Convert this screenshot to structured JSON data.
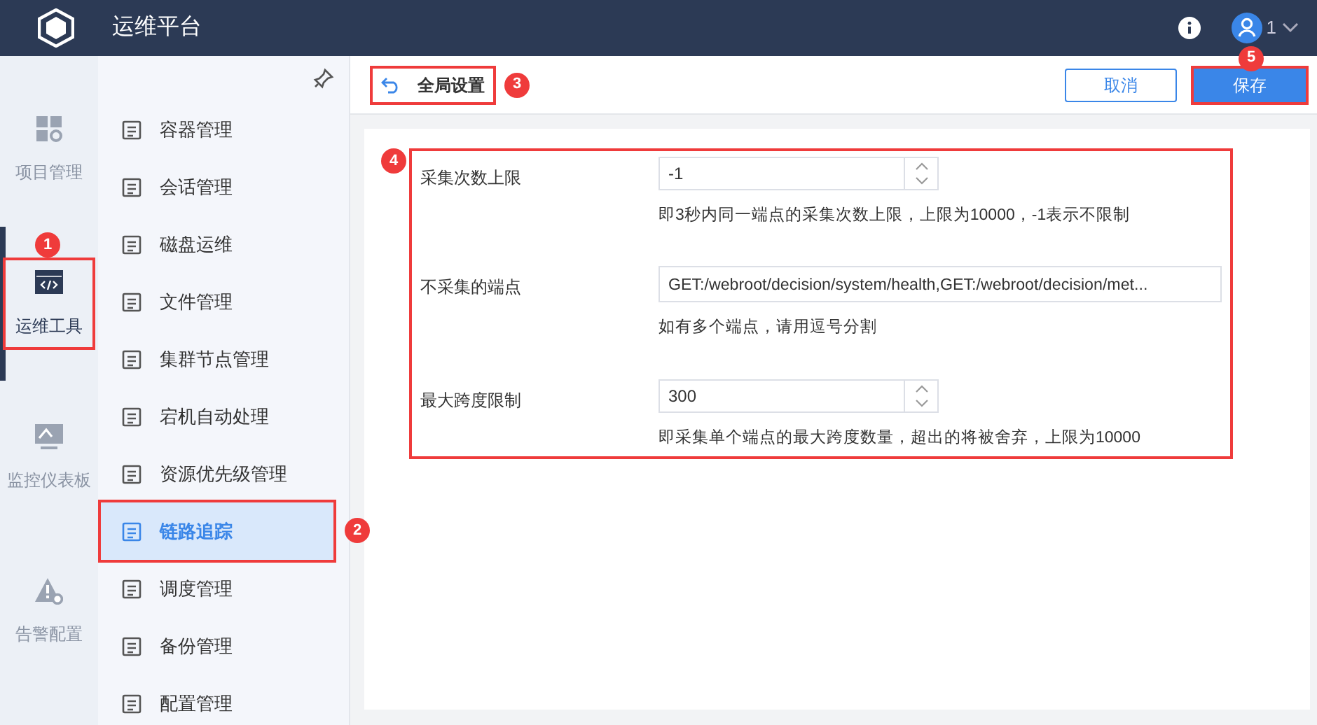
{
  "app": {
    "title": "运维平台",
    "user": "1"
  },
  "rail": [
    {
      "label": "项目管理",
      "selected": false
    },
    {
      "label": "运维工具",
      "selected": true,
      "callout": "1"
    },
    {
      "label": "监控仪表板",
      "selected": false
    },
    {
      "label": "告警配置",
      "selected": false
    }
  ],
  "menu": [
    {
      "label": "容器管理",
      "selected": false
    },
    {
      "label": "会话管理",
      "selected": false
    },
    {
      "label": "磁盘运维",
      "selected": false
    },
    {
      "label": "文件管理",
      "selected": false
    },
    {
      "label": "集群节点管理",
      "selected": false
    },
    {
      "label": "宕机自动处理",
      "selected": false
    },
    {
      "label": "资源优先级管理",
      "selected": false
    },
    {
      "label": "链路追踪",
      "selected": true,
      "callout": "2"
    },
    {
      "label": "调度管理",
      "selected": false
    },
    {
      "label": "备份管理",
      "selected": false
    },
    {
      "label": "配置管理",
      "selected": false
    }
  ],
  "header": {
    "title": "全局设置",
    "title_callout": "3",
    "cancel": "取消",
    "save": "保存",
    "save_callout": "5"
  },
  "form": {
    "callout": "4",
    "fields": [
      {
        "label": "采集次数上限",
        "kind": "number",
        "value": "-1",
        "hint": "即3秒内同一端点的采集次数上限，上限为10000，-1表示不限制"
      },
      {
        "label": "不采集的端点",
        "kind": "text",
        "value": "GET:/webroot/decision/system/health,GET:/webroot/decision/met...",
        "hint": "如有多个端点，请用逗号分割"
      },
      {
        "label": "最大跨度限制",
        "kind": "number",
        "value": "300",
        "hint": "即采集单个端点的最大跨度数量，超出的将被舍弃，上限为10000"
      }
    ]
  }
}
